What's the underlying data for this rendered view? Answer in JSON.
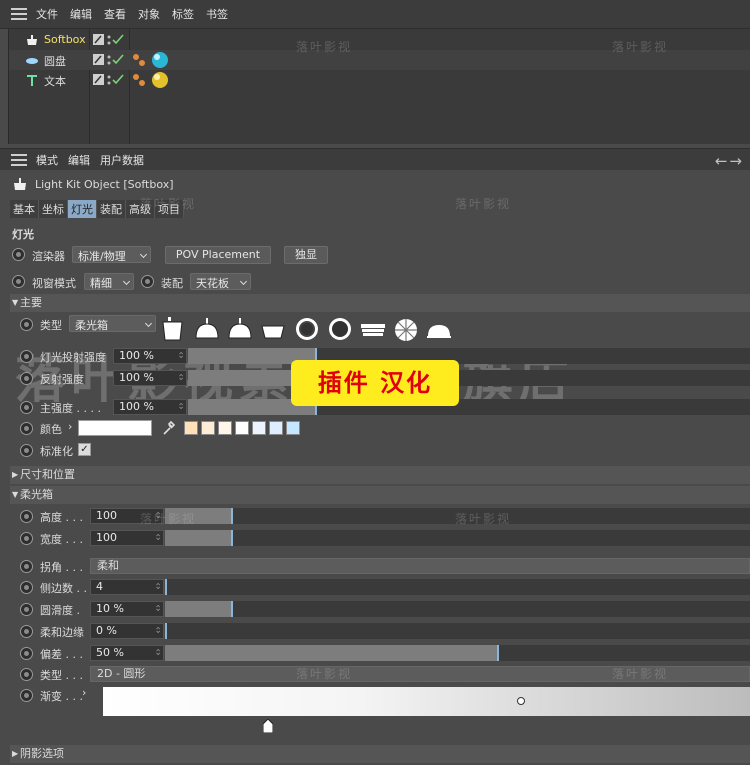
{
  "menubar": {
    "items": [
      "文件",
      "编辑",
      "查看",
      "对象",
      "标签",
      "书签"
    ]
  },
  "objects": [
    {
      "name": "Softbox",
      "icon": "softbox-icon",
      "selected": true
    },
    {
      "name": "圆盘",
      "icon": "disc-icon",
      "selected": false
    },
    {
      "name": "文本",
      "icon": "text-icon",
      "selected": false
    }
  ],
  "attr_menu": {
    "items": [
      "模式",
      "编辑",
      "用户数据"
    ]
  },
  "object_title": "Light Kit Object [Softbox]",
  "tabs": [
    "基本",
    "坐标",
    "灯光",
    "装配",
    "高级",
    "项目"
  ],
  "active_tab": "灯光",
  "section_title": "灯光",
  "renderer": {
    "label": "渲染器",
    "value": "标准/物理",
    "pov_button": "POV Placement",
    "solo_button": "独显"
  },
  "viewport": {
    "mode_label": "视窗模式",
    "mode_value": "精细",
    "rig_label": "装配",
    "rig_value": "天花板"
  },
  "group_main": "主要",
  "type_row": {
    "label": "类型",
    "value": "柔光箱"
  },
  "params_main": [
    {
      "label": "灯光投射强度",
      "value": "100 %"
    },
    {
      "label": "反射强度",
      "value": "100 %"
    },
    {
      "label": "主强度",
      "dots": ". . . .",
      "value": "100 %"
    }
  ],
  "color_label": "颜色",
  "swatch_colors": [
    "#ffe0b8",
    "#ffecd6",
    "#fff5ea",
    "#ffffff",
    "#eef4ff",
    "#dfeeff",
    "#c4e8ff"
  ],
  "normalize_label": "标准化",
  "group_size": "尺寸和位置",
  "group_softbox": "柔光箱",
  "softbox_size": [
    {
      "label": "高度",
      "dots": ". . .",
      "value": "100"
    },
    {
      "label": "宽度",
      "dots": ". . .",
      "value": "100"
    }
  ],
  "corner": {
    "label": "拐角",
    "dots": ". . .",
    "value": "柔和"
  },
  "softbox_params": [
    {
      "label": "侧边数",
      "dots": ". .",
      "value": "4"
    },
    {
      "label": "圆滑度",
      "dots": ".",
      "value": "10 %"
    },
    {
      "label": "柔和边缘",
      "dots": "",
      "value": "0 %"
    },
    {
      "label": "偏差",
      "dots": ". . .",
      "value": "50 %"
    }
  ],
  "shape_type": {
    "label": "类型",
    "dots": ". . .",
    "value": "2D - 圆形"
  },
  "gradient": {
    "label": "渐变",
    "dots": ". . ."
  },
  "group_shadow": "阴影选项",
  "banner": "插件 汉化",
  "watermark_small": "落叶影视",
  "watermark_big": "落叶影视素材基地旗店",
  "accent_color": "#8ab6dd"
}
